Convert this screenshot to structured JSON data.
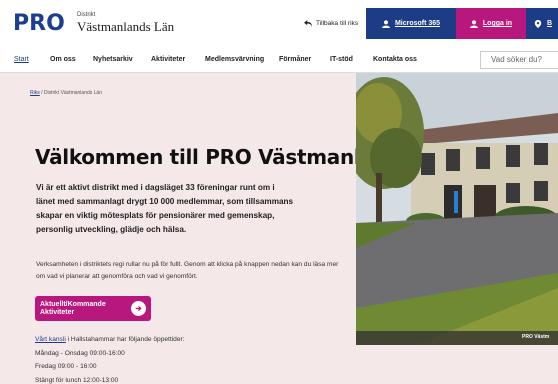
{
  "header": {
    "logo": "PRO",
    "org_label": "Distrikt",
    "org_name": "Västmanlands Län",
    "back_link": "Tillbaka till riks",
    "microsoft_label": "Microsoft 365",
    "login_label": "Logga in",
    "third_label": "B",
    "colors": {
      "brand_blue": "#1c3c86",
      "brand_pink": "#b8177e"
    }
  },
  "nav": {
    "items": [
      {
        "label": "Start",
        "active": true
      },
      {
        "label": "Om oss"
      },
      {
        "label": "Nyhetsarkiv"
      },
      {
        "label": "Aktiviteter"
      },
      {
        "label": "Medlemsvärvning"
      },
      {
        "label": "Förmåner"
      },
      {
        "label": "IT-stöd"
      },
      {
        "label": "Kontakta oss"
      }
    ],
    "search_placeholder": "Vad söker du?"
  },
  "hero": {
    "breadcrumb": {
      "home": "Riks",
      "sep": "/",
      "current": "Distrikt Västmanlands Län"
    },
    "title": "Välkommen till PRO Västmanland",
    "lead": "Vi är ett aktivt distrikt med i dagsläget 33 föreningar runt om i länet med sammanlagt drygt 10 000 medlemmar, som tillsammans skapar en viktig mötesplats för pensionärer med gemenskap, personlig utveckling, glädje och hälsa.",
    "body": "Verksamheten i distriktets regi rullar nu på för fullt. Genom att klicka på knappen nedan kan du läsa mer om vad vi planerar att genomföra och vad vi genomfört.",
    "cta_line1": "Aktuellt/Kommande",
    "cta_line2": "Aktiviteter",
    "office_link": "Vårt kansli",
    "office_text": " i Hallstahammar har följande öppettider:",
    "hours": [
      "Måndag - Onsdag 09:00-16:00",
      "Fredag 09:00 - 16:00",
      "Stängt för lunch 12:00-13:00"
    ],
    "photo_caption": "PRO Västm"
  }
}
